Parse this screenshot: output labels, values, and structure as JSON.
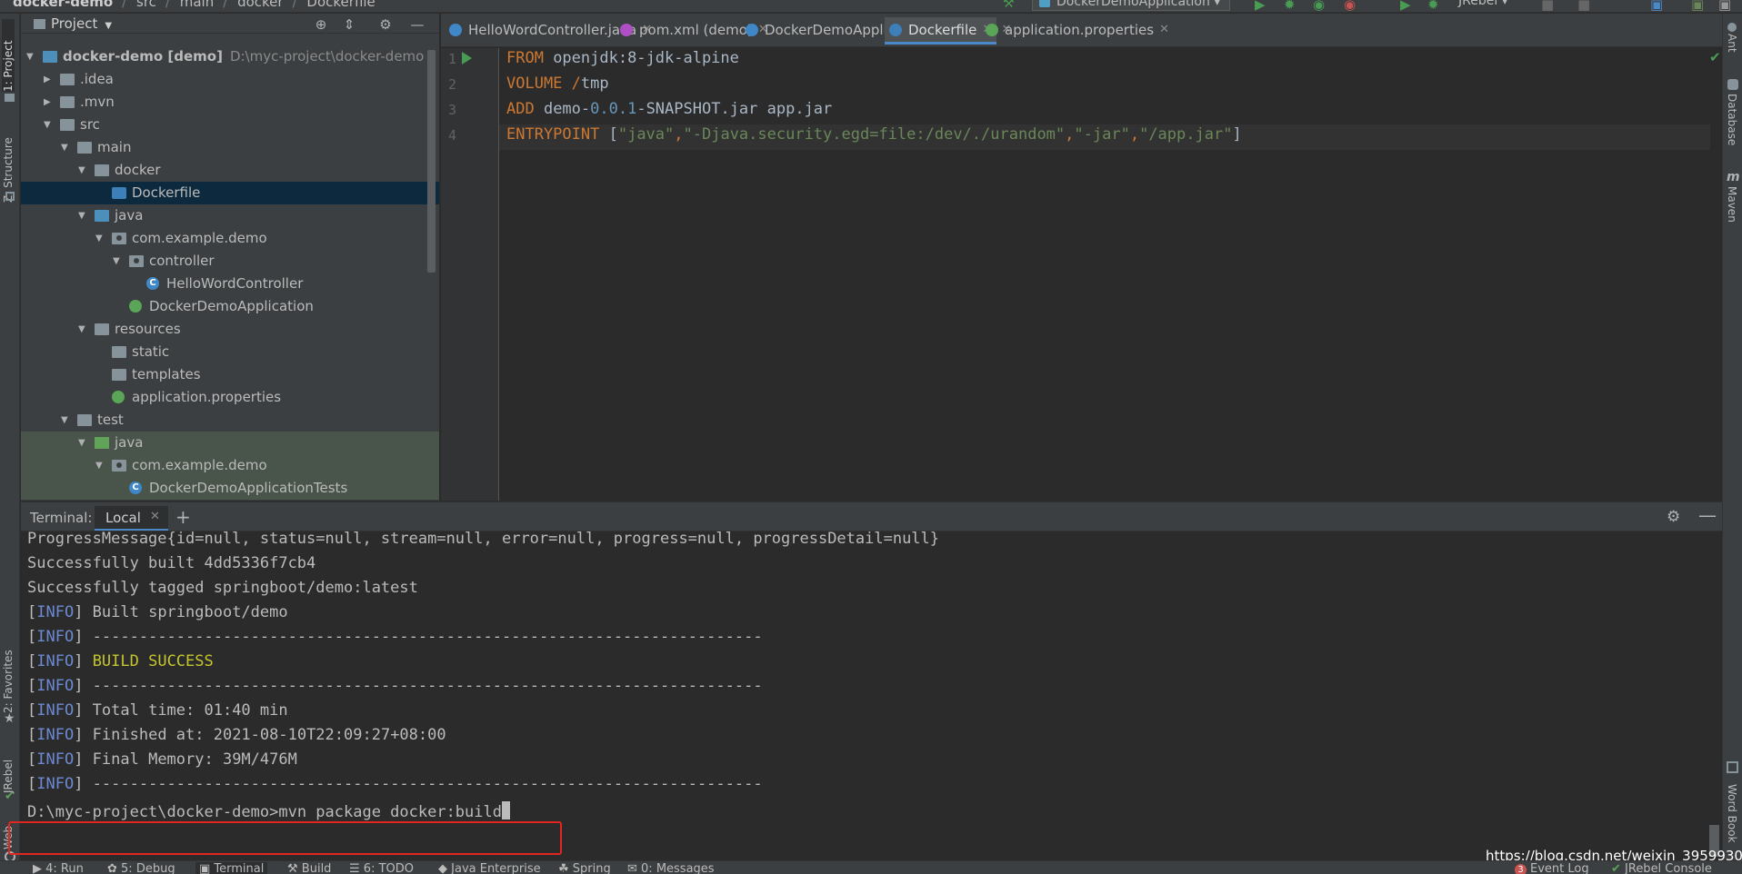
{
  "breadcrumb": [
    "docker-demo",
    "src",
    "main",
    "docker",
    "Dockerfile"
  ],
  "toolbar": {
    "run_config": "DockerDemoApplication",
    "jrebel": "JRebel"
  },
  "left_stripe": {
    "project": "1: Project",
    "structure": "Z: Structure",
    "favorites": "2: Favorites",
    "jrebel": "JRebel",
    "web": "Web"
  },
  "right_stripe": {
    "ant": "Ant",
    "database": "Database",
    "maven": "Maven",
    "word_book": "Word Book"
  },
  "project_panel": {
    "title": "Project",
    "tree": [
      {
        "label": "docker-demo [demo]",
        "extra": "D:\\myc-project\\docker-demo",
        "depth": 0,
        "expanded": true,
        "icon": "module-folder-icon"
      },
      {
        "label": ".idea",
        "depth": 1,
        "expanded": false,
        "icon": "folder-icon"
      },
      {
        "label": ".mvn",
        "depth": 1,
        "expanded": false,
        "icon": "folder-icon"
      },
      {
        "label": "src",
        "depth": 1,
        "expanded": true,
        "icon": "folder-icon"
      },
      {
        "label": "main",
        "depth": 2,
        "expanded": true,
        "icon": "folder-icon"
      },
      {
        "label": "docker",
        "depth": 3,
        "expanded": true,
        "icon": "folder-icon"
      },
      {
        "label": "Dockerfile",
        "depth": 4,
        "icon": "dockerfile-icon",
        "selected": true
      },
      {
        "label": "java",
        "depth": 3,
        "expanded": true,
        "icon": "source-folder-icon"
      },
      {
        "label": "com.example.demo",
        "depth": 4,
        "expanded": true,
        "icon": "package-icon"
      },
      {
        "label": "controller",
        "depth": 5,
        "expanded": true,
        "icon": "package-icon"
      },
      {
        "label": "HelloWordController",
        "depth": 6,
        "icon": "class-icon"
      },
      {
        "label": "DockerDemoApplication",
        "depth": 5,
        "icon": "spring-class-icon"
      },
      {
        "label": "resources",
        "depth": 3,
        "expanded": true,
        "icon": "resources-folder-icon"
      },
      {
        "label": "static",
        "depth": 4,
        "icon": "folder-icon"
      },
      {
        "label": "templates",
        "depth": 4,
        "icon": "folder-icon"
      },
      {
        "label": "application.properties",
        "depth": 4,
        "icon": "spring-properties-icon"
      },
      {
        "label": "test",
        "depth": 2,
        "expanded": true,
        "icon": "folder-icon"
      },
      {
        "label": "java",
        "depth": 3,
        "expanded": true,
        "icon": "test-folder-icon",
        "test": true
      },
      {
        "label": "com.example.demo",
        "depth": 4,
        "expanded": true,
        "icon": "package-icon",
        "test": true
      },
      {
        "label": "DockerDemoApplicationTests",
        "depth": 5,
        "icon": "test-class-icon",
        "test": true
      }
    ]
  },
  "tabs": [
    {
      "label": "HelloWordController.java",
      "icon_color": "#3f87c6"
    },
    {
      "label": "pom.xml (demo)",
      "icon_color": "#b04fc5"
    },
    {
      "label": "DockerDemoApplicationTests.java",
      "icon_color": "#3f87c6"
    },
    {
      "label": "Dockerfile",
      "icon_color": "#3d7fb8",
      "active": true
    },
    {
      "label": "application.properties",
      "icon_color": "#5aa557"
    }
  ],
  "editor": {
    "line_numbers": [
      "1",
      "2",
      "3",
      "4"
    ],
    "lines": [
      [
        {
          "t": "FROM",
          "c": "kw"
        },
        {
          "t": " openjdk:8-jdk-alpine",
          "c": ""
        }
      ],
      [
        {
          "t": "VOLUME",
          "c": "kw"
        },
        {
          "t": " ",
          "c": ""
        },
        {
          "t": "/",
          "c": "slash"
        },
        {
          "t": "tmp",
          "c": ""
        }
      ],
      [
        {
          "t": "ADD",
          "c": "kw"
        },
        {
          "t": " demo-",
          "c": ""
        },
        {
          "t": "0.0.1",
          "c": "num"
        },
        {
          "t": "-SNAPSHOT.jar app.jar",
          "c": ""
        }
      ],
      [
        {
          "t": "ENTRYPOINT",
          "c": "kw"
        },
        {
          "t": " [",
          "c": ""
        },
        {
          "t": "\"java\"",
          "c": "str"
        },
        {
          "t": ",",
          "c": "kw"
        },
        {
          "t": "\"-Djava.security.egd=file:/dev/./urandom\"",
          "c": "str"
        },
        {
          "t": ",",
          "c": "kw"
        },
        {
          "t": "\"-jar\"",
          "c": "str"
        },
        {
          "t": ",",
          "c": "kw"
        },
        {
          "t": "\"/app.jar\"",
          "c": "str"
        },
        {
          "t": "]",
          "c": ""
        }
      ]
    ]
  },
  "terminal": {
    "title": "Terminal:",
    "tab": "Local",
    "lines": [
      [
        {
          "t": "ProgressMessage{id=null, status=null, stream=null, error=null, progress=null, progressDetail=null}",
          "c": ""
        }
      ],
      [
        {
          "t": "Successfully built 4dd5336f7cb4",
          "c": ""
        }
      ],
      [
        {
          "t": "Successfully tagged springboot/demo:latest",
          "c": ""
        }
      ],
      [
        {
          "t": "[",
          "c": ""
        },
        {
          "t": "INFO",
          "c": "tinfo"
        },
        {
          "t": "] Built springboot/demo",
          "c": ""
        }
      ],
      [
        {
          "t": "[",
          "c": ""
        },
        {
          "t": "INFO",
          "c": "tinfo"
        },
        {
          "t": "] ------------------------------------------------------------------------",
          "c": ""
        }
      ],
      [
        {
          "t": "[",
          "c": ""
        },
        {
          "t": "INFO",
          "c": "tinfo"
        },
        {
          "t": "] ",
          "c": ""
        },
        {
          "t": "BUILD SUCCESS",
          "c": "tsuccess"
        }
      ],
      [
        {
          "t": "[",
          "c": ""
        },
        {
          "t": "INFO",
          "c": "tinfo"
        },
        {
          "t": "] ------------------------------------------------------------------------",
          "c": ""
        }
      ],
      [
        {
          "t": "[",
          "c": ""
        },
        {
          "t": "INFO",
          "c": "tinfo"
        },
        {
          "t": "] Total time: 01:40 min",
          "c": ""
        }
      ],
      [
        {
          "t": "[",
          "c": ""
        },
        {
          "t": "INFO",
          "c": "tinfo"
        },
        {
          "t": "] Finished at: 2021-08-10T22:09:27+08:00",
          "c": ""
        }
      ],
      [
        {
          "t": "[",
          "c": ""
        },
        {
          "t": "INFO",
          "c": "tinfo"
        },
        {
          "t": "] Final Memory: 39M/476M",
          "c": ""
        }
      ],
      [
        {
          "t": "[",
          "c": ""
        },
        {
          "t": "INFO",
          "c": "tinfo"
        },
        {
          "t": "] ------------------------------------------------------------------------",
          "c": ""
        }
      ]
    ],
    "prompt": "D:\\myc-project\\docker-demo>",
    "command": "mvn package docker:build"
  },
  "bottom_tools": [
    {
      "label": "4: Run",
      "icon": "run-icon"
    },
    {
      "label": "5: Debug",
      "icon": "debug-icon"
    },
    {
      "label": "Terminal",
      "icon": "terminal-icon",
      "active": true
    },
    {
      "label": "Build",
      "icon": "build-icon"
    },
    {
      "label": "6: TODO",
      "icon": "todo-icon"
    },
    {
      "label": "Java Enterprise",
      "icon": "java-enterprise-icon"
    },
    {
      "label": "Spring",
      "icon": "spring-icon"
    },
    {
      "label": "0: Messages",
      "icon": "messages-icon"
    }
  ],
  "bottom_right": {
    "event_log": "Event Log",
    "event_count": "3",
    "jrebel_console": "JRebel Console"
  },
  "watermark": "https://blog.csdn.net/weixin_39599307",
  "colors": {
    "accent": "#4a88c7",
    "highlight_box": "#e0261f"
  }
}
